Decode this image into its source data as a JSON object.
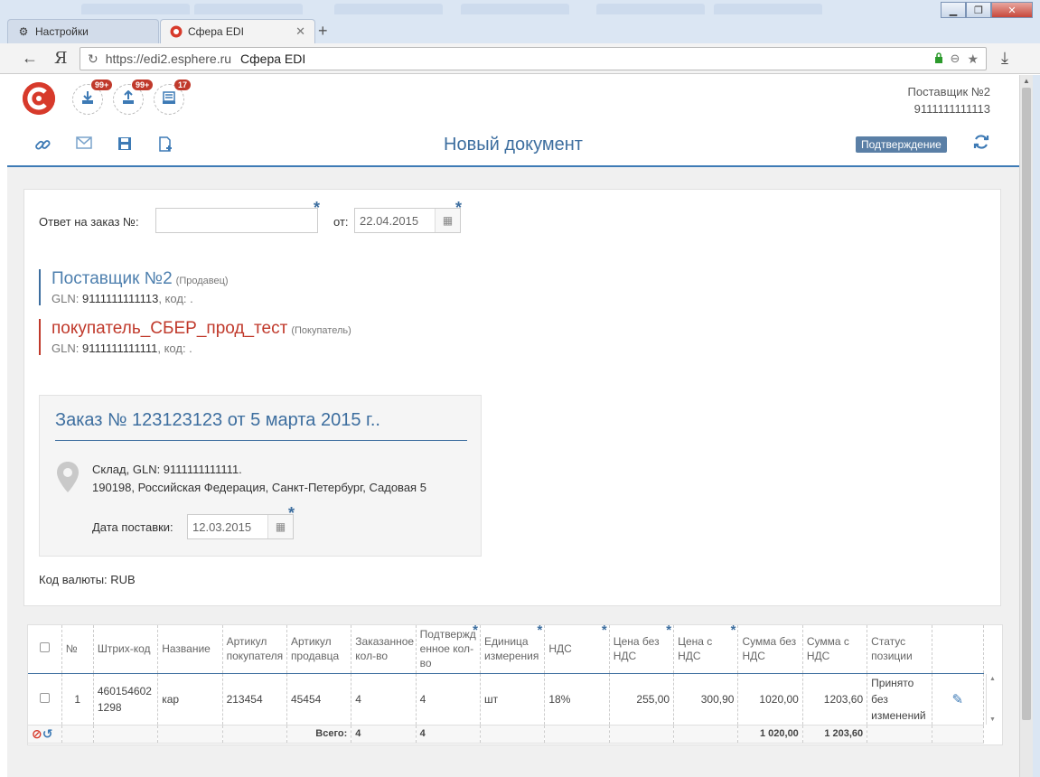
{
  "browser": {
    "tabs": [
      {
        "label": "Настройки",
        "icon": "gear-icon",
        "active": false
      },
      {
        "label": "Сфера EDI",
        "icon": "esphere-logo-icon",
        "active": true
      }
    ],
    "new_tab": "+",
    "url": "https://edi2.esphere.ru",
    "page_title": "Сфера EDI",
    "yandex_label": "Я"
  },
  "header": {
    "badges": [
      {
        "icon": "inbox-download-icon",
        "count": "99+"
      },
      {
        "icon": "outbox-upload-icon",
        "count": "99+"
      },
      {
        "icon": "archive-tray-icon",
        "count": "17"
      }
    ],
    "supplier_name": "Поставщик №2",
    "supplier_gln": "9111111111113",
    "page_title": "Новый документ",
    "confirm_label": "Подтверждение"
  },
  "form": {
    "order_reply_label": "Ответ на заказ №:",
    "order_reply_value": "",
    "from_label": "от:",
    "from_date": "22.04.2015",
    "seller": {
      "name": "Поставщик №2",
      "role": "(Продавец)",
      "gln_prefix": "GLN:",
      "gln": "9111111111113",
      "code_suffix": ", код: ."
    },
    "buyer": {
      "name": "покупатель_СБЕР_прод_тест",
      "role": "(Покупатель)",
      "gln_prefix": "GLN:",
      "gln": "9111111111111",
      "code_suffix": ", код: ."
    },
    "order": {
      "title": "Заказ № 123123123 от 5 марта 2015 г..",
      "address_line1": "Склад, GLN: 9111111111111.",
      "address_line2": "190198, Российская Федерация, Санкт-Петербург, Садовая 5",
      "delivery_label": "Дата поставки:",
      "delivery_date": "12.03.2015"
    },
    "currency_label": "Код валюты: RUB"
  },
  "table": {
    "columns": [
      {
        "key": "cb",
        "label": "",
        "required": false
      },
      {
        "key": "num",
        "label": "№",
        "required": false
      },
      {
        "key": "barcode",
        "label": "Штрих-код",
        "required": false
      },
      {
        "key": "name",
        "label": "Название",
        "required": false
      },
      {
        "key": "buyer_art",
        "label": "Артикул покупателя",
        "required": false
      },
      {
        "key": "seller_art",
        "label": "Артикул продавца",
        "required": false
      },
      {
        "key": "ordered",
        "label": "Заказанное кол-во",
        "required": false
      },
      {
        "key": "confirmed",
        "label": "Подтвержд енное кол-во",
        "required": true
      },
      {
        "key": "unit",
        "label": "Единица измерения",
        "required": true
      },
      {
        "key": "vat",
        "label": "НДС",
        "required": true
      },
      {
        "key": "price_novat",
        "label": "Цена без НДС",
        "required": true
      },
      {
        "key": "price_vat",
        "label": "Цена с НДС",
        "required": true
      },
      {
        "key": "sum_novat",
        "label": "Сумма без НДС",
        "required": false
      },
      {
        "key": "sum_vat",
        "label": "Сумма с НДС",
        "required": false
      },
      {
        "key": "status",
        "label": "Статус позиции",
        "required": false
      },
      {
        "key": "actions",
        "label": "",
        "required": false
      }
    ],
    "rows": [
      {
        "num": "1",
        "barcode": "4601546021298",
        "name": "кар",
        "buyer_art": "213454",
        "seller_art": "45454",
        "ordered": "4",
        "confirmed": "4",
        "unit": "шт",
        "vat": "18%",
        "price_novat": "255,00",
        "price_vat": "300,90",
        "sum_novat": "1020,00",
        "sum_vat": "1203,60",
        "status": "Принято без изменений"
      }
    ],
    "footer": {
      "total_label": "Всего:",
      "ordered": "4",
      "confirmed": "4",
      "sum_novat": "1 020,00",
      "sum_vat": "1 203,60"
    }
  }
}
